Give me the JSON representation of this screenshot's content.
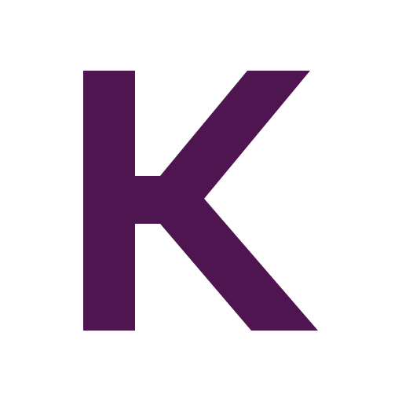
{
  "logo": {
    "letter": "K",
    "color": "#4f1550"
  },
  "background": {
    "color": "#ffffff"
  }
}
